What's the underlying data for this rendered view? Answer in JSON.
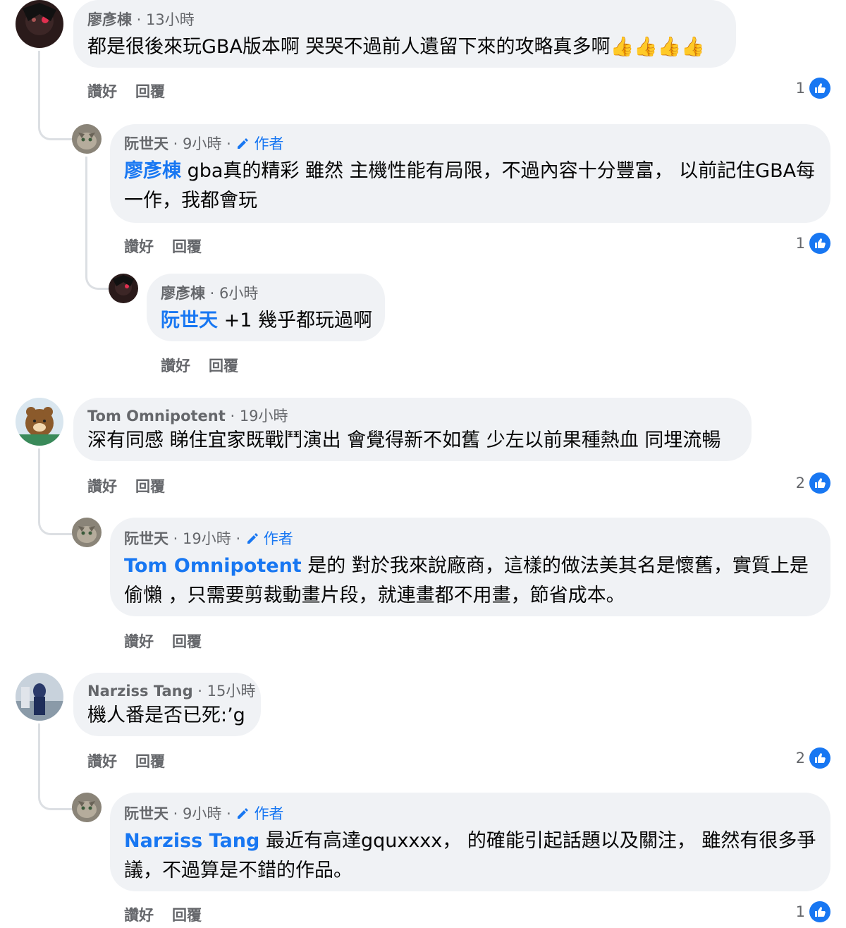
{
  "comments": [
    {
      "name": "廖彥棟",
      "time": "13小時",
      "text": "都是很後來玩GBA版本啊 哭哭不過前人遺留下來的攻略真多啊👍👍👍👍",
      "like": "讚好",
      "reply": "回覆",
      "count": "1",
      "replies": [
        {
          "name": "阮世天",
          "time": "9小時",
          "author": "作者",
          "mention": "廖彥棟",
          "text": "gba真的精彩 雖然 主機性能有局限，不過內容十分豐富， 以前記住GBA每一作，我都會玩",
          "like": "讚好",
          "reply": "回覆",
          "count": "1"
        },
        {
          "name": "廖彥棟",
          "time": "6小時",
          "mention": "阮世天",
          "text": "+1 幾乎都玩過啊",
          "like": "讚好",
          "reply": "回覆"
        }
      ]
    },
    {
      "name": "Tom Omnipotent",
      "time": "19小時",
      "text": "深有同感 睇住宜家既戰鬥演出 會覺得新不如舊 少左以前果種熱血 同埋流暢",
      "like": "讚好",
      "reply": "回覆",
      "count": "2",
      "replies": [
        {
          "name": "阮世天",
          "time": "19小時",
          "author": "作者",
          "mention": "Tom Omnipotent",
          "text": "是的 對於我來說廠商，這樣的做法美其名是懷舊，實質上是偷懶 ，只需要剪裁動畫片段，就連畫都不用畫，節省成本。",
          "like": "讚好",
          "reply": "回覆"
        }
      ]
    },
    {
      "name": "Narziss Tang",
      "time": "15小時",
      "text": "機人番是否已死:’g",
      "like": "讚好",
      "reply": "回覆",
      "count": "2",
      "replies": [
        {
          "name": "阮世天",
          "time": "9小時",
          "author": "作者",
          "mention": "Narziss Tang",
          "text": "最近有高達gquxxxx， 的確能引起話題以及關注， 雖然有很多爭議，不過算是不錯的作品。",
          "like": "讚好",
          "reply": "回覆",
          "count": "1"
        }
      ]
    }
  ],
  "colors": {
    "accent": "#1877f2",
    "bubble": "#f0f2f5",
    "meta": "#65676b"
  }
}
